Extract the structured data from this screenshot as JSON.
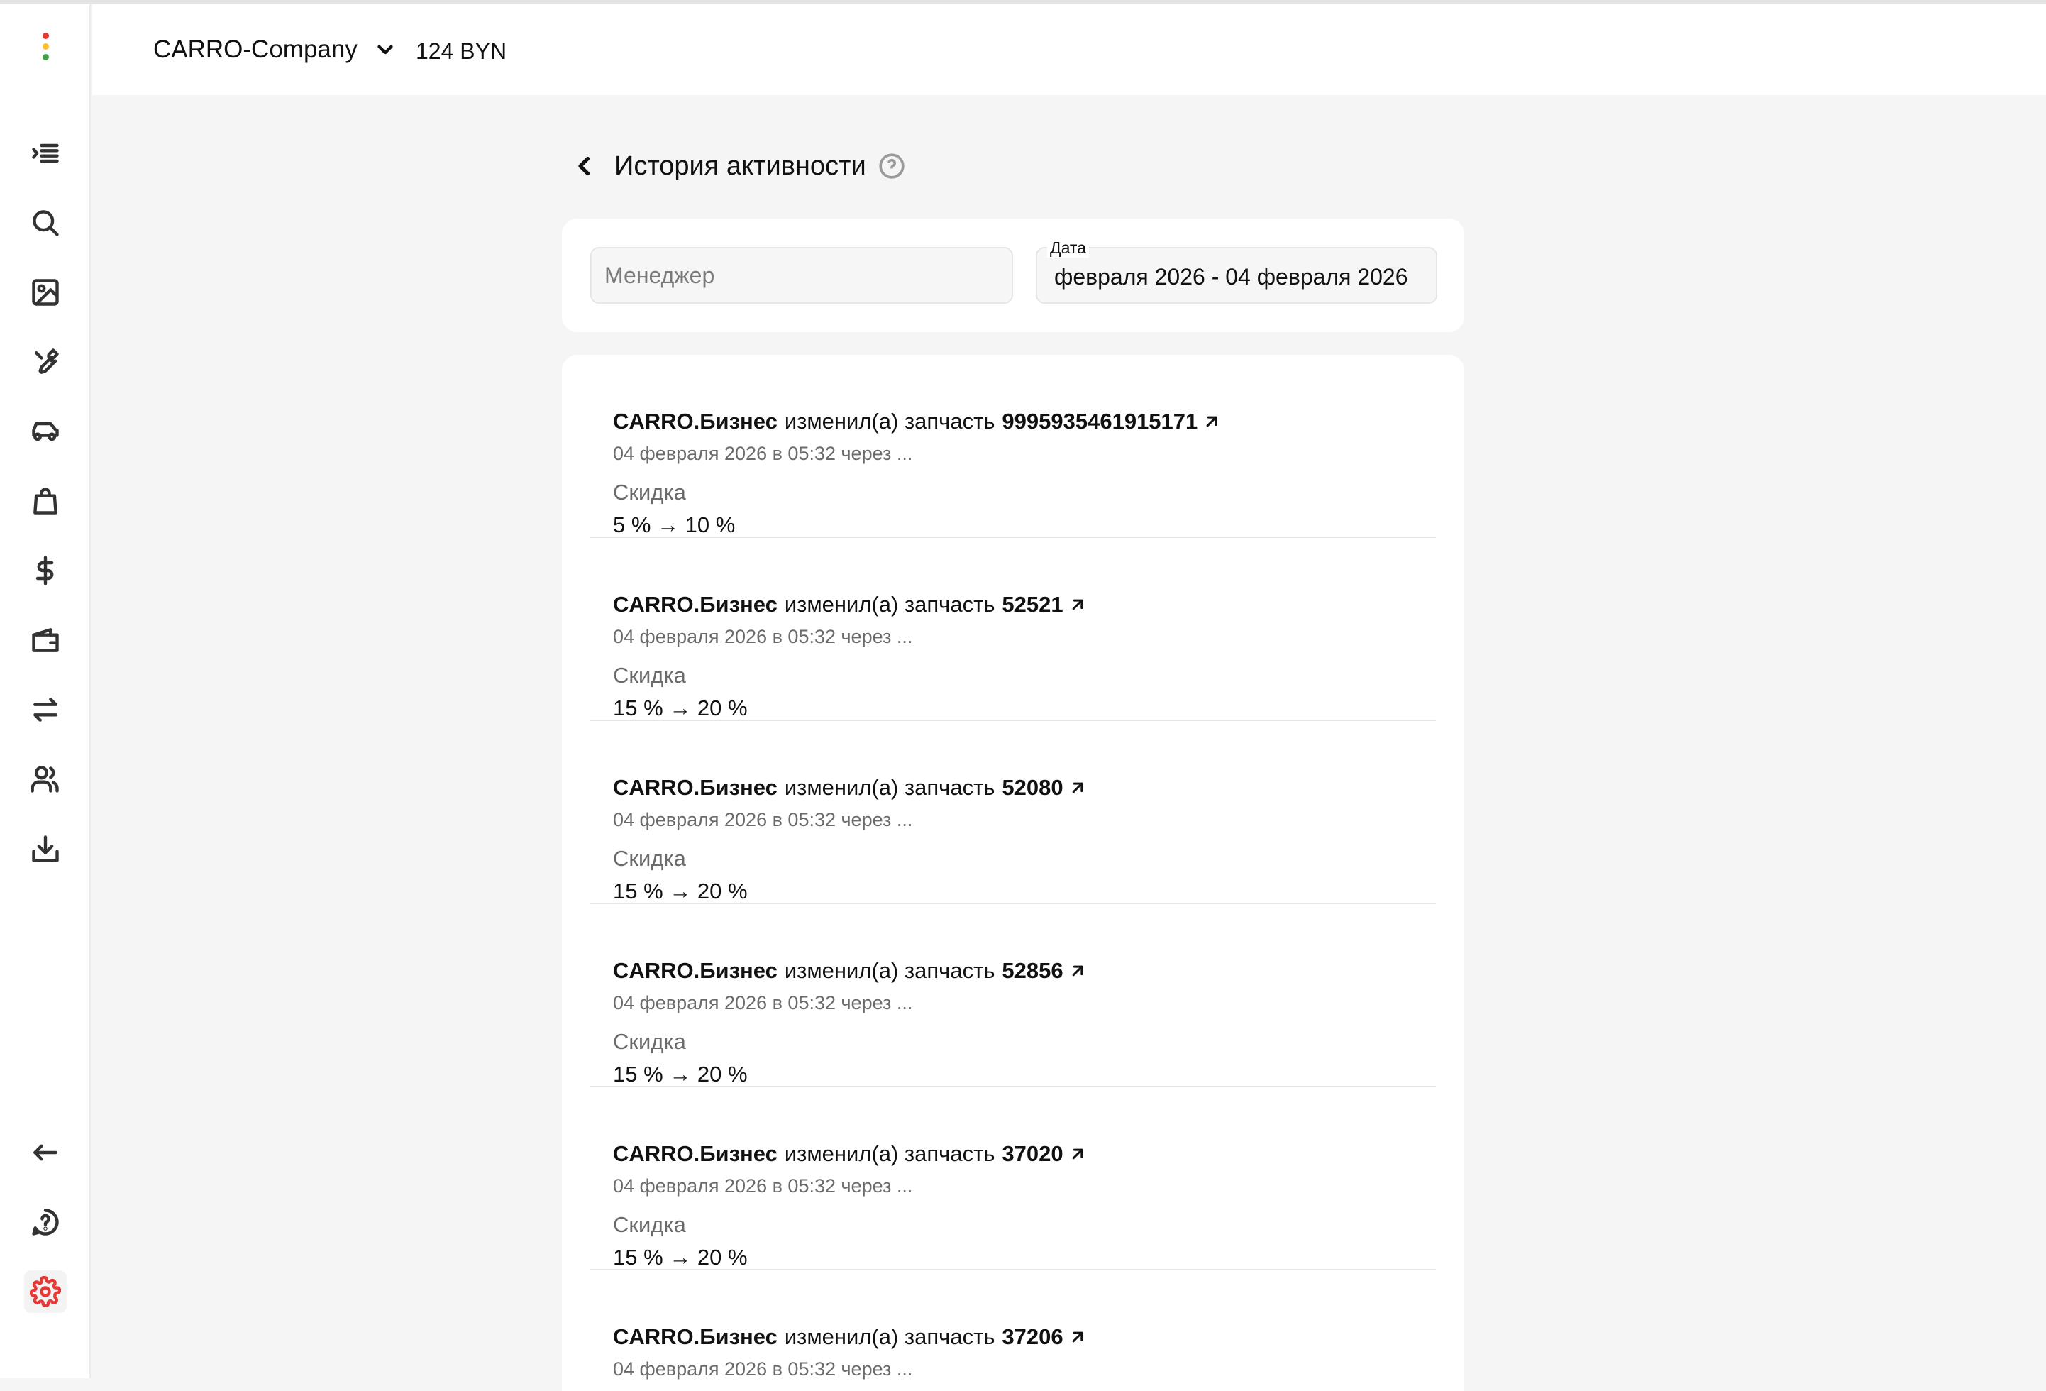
{
  "colors": {
    "accent": "#e53935",
    "logo_dots": [
      "#e53935",
      "#fbc02d",
      "#43a047"
    ]
  },
  "sidebar": {
    "top_icons": [
      "collapse-menu-icon",
      "search-icon",
      "image-icon",
      "wrench-icon",
      "car-icon",
      "shopping-bag-icon",
      "dollar-icon",
      "wallet-icon",
      "transfer-arrows-icon",
      "users-icon",
      "download-icon"
    ],
    "bottom_icons": [
      "logout-arrow-icon",
      "help-chat-icon",
      "settings-gear-icon"
    ],
    "active": "settings-gear-icon"
  },
  "header": {
    "company": "CARRO-Company",
    "balance": "124 BYN"
  },
  "page": {
    "title": "История активности"
  },
  "filters": {
    "manager_placeholder": "Менеджер",
    "date_label": "Дата",
    "date_value": "февраля 2026 - 04 февраля 2026"
  },
  "entries": [
    {
      "actor": "CARRO.Бизнес",
      "action": "изменил(а) запчасть",
      "part": "9995935461915171",
      "meta": "04 февраля 2026 в 05:32 через ...",
      "field": "Скидка",
      "change": "5 % → 10 %"
    },
    {
      "actor": "CARRO.Бизнес",
      "action": "изменил(а) запчасть",
      "part": "52521",
      "meta": "04 февраля 2026 в 05:32 через ...",
      "field": "Скидка",
      "change": "15 % → 20 %"
    },
    {
      "actor": "CARRO.Бизнес",
      "action": "изменил(а) запчасть",
      "part": "52080",
      "meta": "04 февраля 2026 в 05:32 через ...",
      "field": "Скидка",
      "change": "15 % → 20 %"
    },
    {
      "actor": "CARRO.Бизнес",
      "action": "изменил(а) запчасть",
      "part": "52856",
      "meta": "04 февраля 2026 в 05:32 через ...",
      "field": "Скидка",
      "change": "15 % → 20 %"
    },
    {
      "actor": "CARRO.Бизнес",
      "action": "изменил(а) запчасть",
      "part": "37020",
      "meta": "04 февраля 2026 в 05:32 через ...",
      "field": "Скидка",
      "change": "15 % → 20 %"
    },
    {
      "actor": "CARRO.Бизнес",
      "action": "изменил(а) запчасть",
      "part": "37206",
      "meta": "04 февраля 2026 в 05:32 через ...",
      "field": "",
      "change": ""
    }
  ]
}
